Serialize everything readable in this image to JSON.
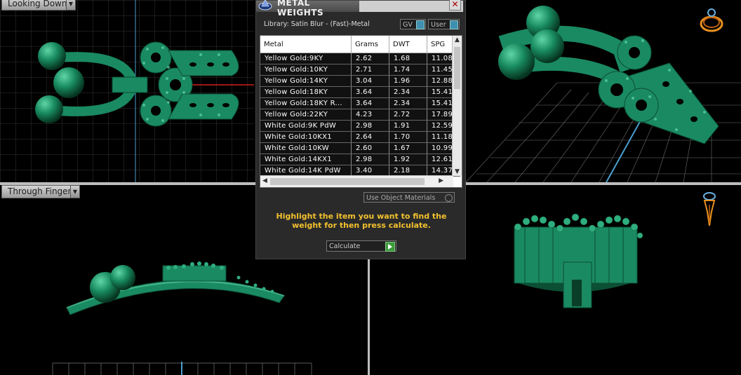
{
  "viewports": {
    "top_left_label": "Looking Down",
    "bottom_left_label": "Through Finger"
  },
  "dialog": {
    "title": "METAL WEIGHTS",
    "close": "✕",
    "library": "Library: Satin Blur - (Fast)-Metal",
    "gv_label": "GV",
    "user_label": "User",
    "columns": [
      "Metal",
      "Grams",
      "DWT",
      "SPG"
    ],
    "rows": [
      [
        "Yellow Gold:9KY",
        "2.62",
        "1.68",
        "11.08"
      ],
      [
        "Yellow Gold:10KY",
        "2.71",
        "1.74",
        "11.45"
      ],
      [
        "Yellow Gold:14KY",
        "3.04",
        "1.96",
        "12.88"
      ],
      [
        "Yellow Gold:18KY",
        "3.64",
        "2.34",
        "15.41"
      ],
      [
        "Yellow Gold:18KY R...",
        "3.64",
        "2.34",
        "15.41"
      ],
      [
        "Yellow Gold:22KY",
        "4.23",
        "2.72",
        "17.89"
      ],
      [
        "White Gold:9K PdW",
        "2.98",
        "1.91",
        "12.59"
      ],
      [
        "White Gold:10KX1",
        "2.64",
        "1.70",
        "11.18"
      ],
      [
        "White Gold:10KW",
        "2.60",
        "1.67",
        "10.99"
      ],
      [
        "White Gold:14KX1",
        "2.98",
        "1.92",
        "12.61"
      ],
      [
        "White Gold:14K PdW",
        "3.40",
        "2.18",
        "14.37"
      ]
    ],
    "use_object_materials": "Use Object Materials",
    "hint": "Highlight the item you want to find the weight for then press calculate.",
    "calculate": "Calculate"
  },
  "colors": {
    "metal_green": "#1a8a62",
    "hint_yellow": "#f2c12e",
    "gizmo_orange": "#e89020"
  },
  "icons": {
    "ring_gizmo": "ring-orientation-icon",
    "pin_gizmo": "ring-side-orientation-icon",
    "dialog_logo": "metal-weights-icon"
  }
}
